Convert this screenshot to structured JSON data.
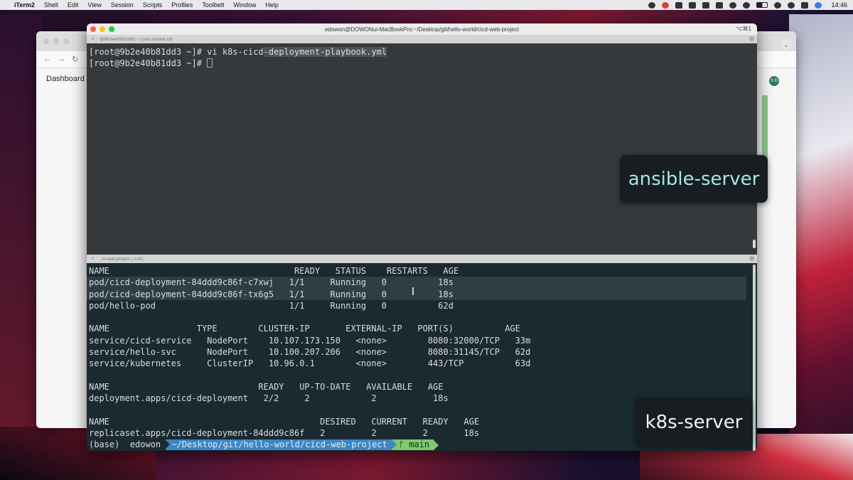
{
  "menubar": {
    "app_name": "iTerm2",
    "menus": [
      "Shell",
      "Edit",
      "View",
      "Session",
      "Scripts",
      "Profiles",
      "Toolbelt",
      "Window",
      "Help"
    ],
    "clock": "14:46"
  },
  "browser": {
    "dashboard_label": "Dashboard",
    "avatar_initials": "S D"
  },
  "iterm": {
    "title": "edowon@DOWONui-MacBookPro:~/Desktop/git/hello-world/cicd-web-project",
    "shortcut": "⌥⌘1",
    "top_pane": {
      "header": "@9b2e40b81dd3:~ (com.docker.cli)",
      "lines": [
        {
          "prefix": "[root@9b2e40b81dd3 ~]# vi k8s-cicd",
          "selected": "-deployment-playbook.yml"
        },
        {
          "prefix": "[root@9b2e40b81dd3 ~]# ",
          "selected": ""
        }
      ]
    },
    "bottom_pane": {
      "header": "..d-web-project (-zsh)",
      "pods_header": "NAME                                    READY   STATUS    RESTARTS   AGE",
      "pods": [
        "pod/cicd-deployment-84ddd9c86f-c7xwj   1/1     Running   0          18s",
        "pod/cicd-deployment-84ddd9c86f-tx6g5   1/1     Running   0          18s",
        "pod/hello-pod                          1/1     Running   0          62d"
      ],
      "svc_header": "NAME                 TYPE        CLUSTER-IP       EXTERNAL-IP   PORT(S)          AGE",
      "services": [
        "service/cicd-service   NodePort    10.107.173.150   <none>        8080:32000/TCP   33m",
        "service/hello-svc      NodePort    10.100.207.206   <none>        8080:31145/TCP   62d",
        "service/kubernetes     ClusterIP   10.96.0.1        <none>        443/TCP          63d"
      ],
      "deploy_header": "NAME                             READY   UP-TO-DATE   AVAILABLE   AGE",
      "deployments": [
        "deployment.apps/cicd-deployment   2/2     2            2           18s"
      ],
      "rs_header": "NAME                                         DESIRED   CURRENT   READY   AGE",
      "replicasets": [
        "replicaset.apps/cicd-deployment-84ddd9c86f   2         2         2       18s"
      ],
      "prompt": {
        "env": "(base)  edowon ",
        "path": "~/Desktop/git/hello-world/cicd-web-project",
        "branch": "ᚠ main"
      }
    }
  },
  "overlays": {
    "ansible": "ansible-server",
    "k8s": "k8s-server"
  }
}
